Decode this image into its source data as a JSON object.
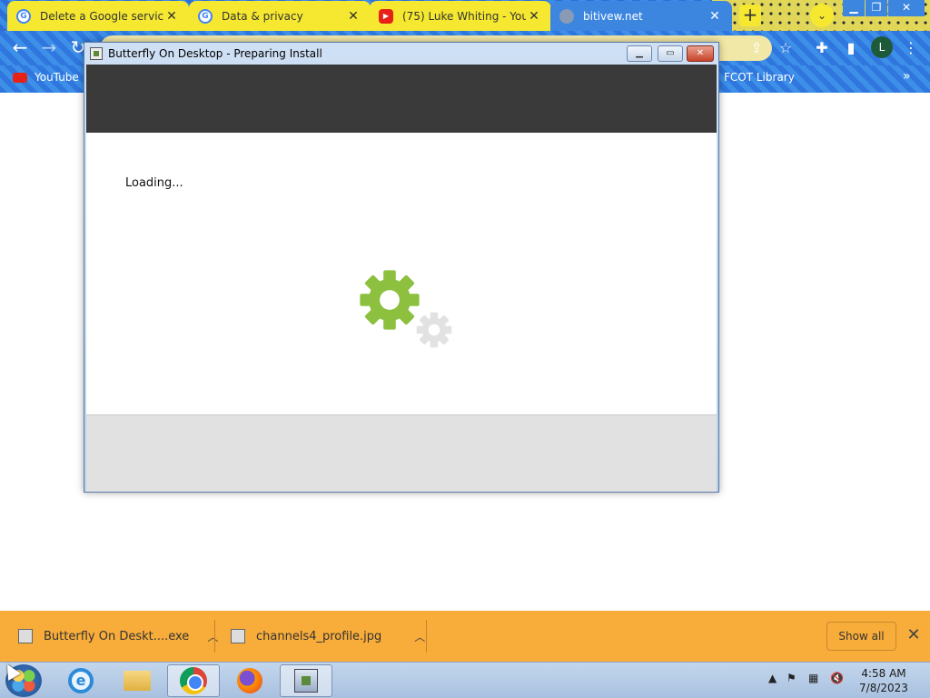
{
  "browser": {
    "tabs": [
      {
        "title": "Delete a Google service",
        "favicon": "google-icon",
        "active": false
      },
      {
        "title": "Data & privacy",
        "favicon": "google-icon",
        "active": false
      },
      {
        "title": "(75) Luke Whiting - YouTube",
        "favicon": "youtube-icon",
        "active": false
      },
      {
        "title": "bitivew.net",
        "favicon": "globe-icon",
        "active": true
      }
    ],
    "new_tab_glyph": "+",
    "tab_search_glyph": "⌄",
    "profile_initial": "L",
    "bookmarks": [
      {
        "label": "YouTube"
      },
      {
        "label": "FCOT Library"
      }
    ],
    "bookmarks_overflow": "»"
  },
  "dialog": {
    "title": "Butterfly On Desktop - Preparing Install",
    "loading_text": "Loading...",
    "accent_color": "#8dc03f"
  },
  "downloads": {
    "items": [
      {
        "name": "Butterfly On Deskt....exe"
      },
      {
        "name": "channels4_profile.jpg"
      }
    ],
    "show_all_label": "Show all"
  },
  "taskbar": {
    "apps": [
      "start-button",
      "internet-explorer",
      "file-explorer",
      "chrome",
      "firefox",
      "installer"
    ],
    "time": "4:58 AM",
    "date": "7/8/2023"
  }
}
